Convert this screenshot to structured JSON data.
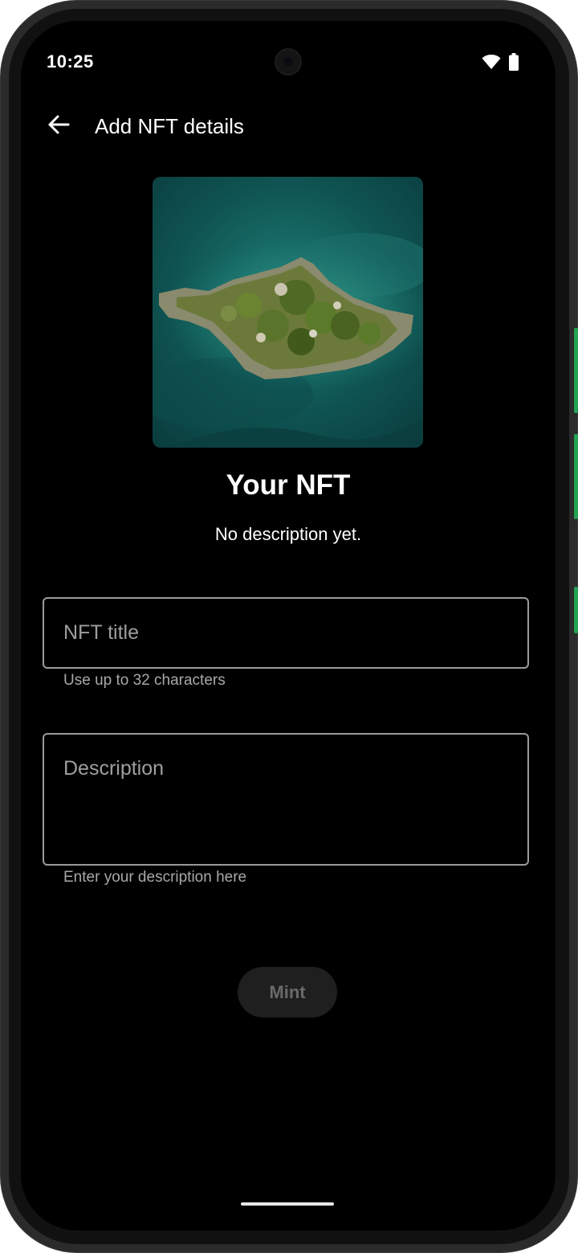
{
  "status_bar": {
    "time": "10:25",
    "icons": [
      "wifi-icon",
      "battery-icon"
    ]
  },
  "app_bar": {
    "back_icon": "arrow-back-icon",
    "title": "Add NFT details"
  },
  "preview": {
    "image": "aerial-island-photo",
    "name": "Your NFT",
    "description": "No description yet."
  },
  "form": {
    "title_field": {
      "placeholder": "NFT title",
      "value": "",
      "helper": "Use up to 32 characters"
    },
    "description_field": {
      "placeholder": "Description",
      "value": "",
      "helper": "Enter your description here"
    },
    "mint_label": "Mint",
    "mint_enabled": false
  },
  "colors": {
    "background": "#000000",
    "field_border": "#9a9a9a",
    "mint_disabled_bg": "#1f1f1f",
    "mint_disabled_text": "#6a6a6a",
    "device_accent": "#22a352"
  }
}
